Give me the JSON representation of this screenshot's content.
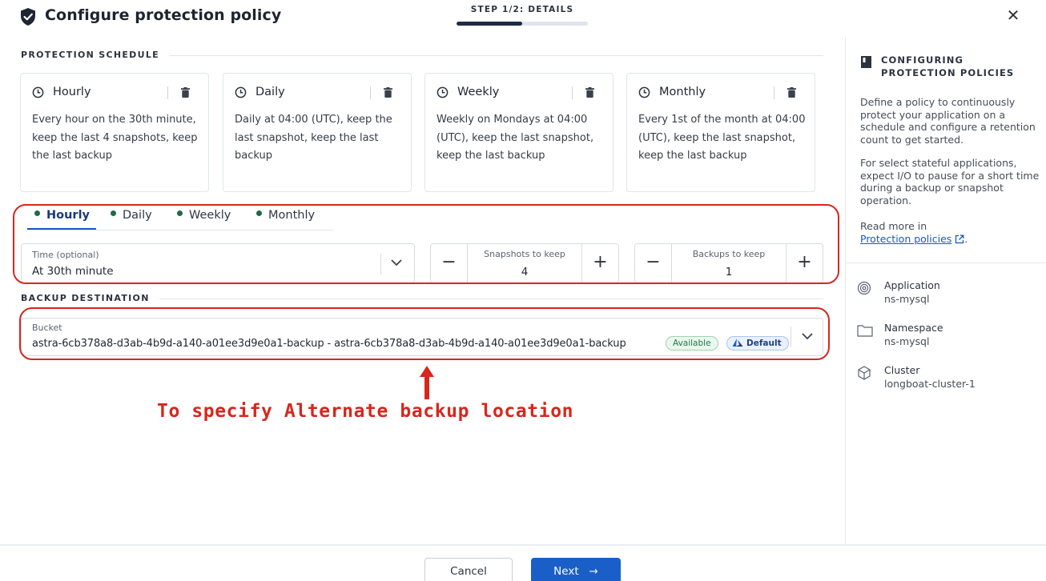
{
  "header": {
    "title": "Configure protection policy",
    "step_label": "STEP 1/2: DETAILS",
    "step_progress": 0.5,
    "close_glyph": "✕"
  },
  "schedule": {
    "heading": "PROTECTION SCHEDULE",
    "cards": [
      {
        "title": "Hourly",
        "description": "Every hour on the 30th minute, keep the last 4 snapshots, keep the last backup"
      },
      {
        "title": "Daily",
        "description": "Daily at 04:00 (UTC), keep the last snapshot, keep the last backup"
      },
      {
        "title": "Weekly",
        "description": "Weekly on Mondays at 04:00 (UTC), keep the last snapshot, keep the last backup"
      },
      {
        "title": "Monthly",
        "description": "Every 1st of the month at 04:00 (UTC), keep the last snapshot, keep the last backup"
      }
    ],
    "tabs": [
      "Hourly",
      "Daily",
      "Weekly",
      "Monthly"
    ],
    "active_tab": "Hourly",
    "time": {
      "label": "Time (optional)",
      "value": "At 30th minute"
    },
    "snapshots": {
      "label": "Snapshots to keep",
      "value": "4",
      "minus": "−",
      "plus": "+"
    },
    "backups": {
      "label": "Backups to keep",
      "value": "1",
      "minus": "−",
      "plus": "+"
    }
  },
  "destination": {
    "heading": "BACKUP DESTINATION",
    "bucket_label": "Bucket",
    "bucket_value": "astra-6cb378a8-d3ab-4b9d-a140-a01ee3d9e0a1-backup - astra-6cb378a8-d3ab-4b9d-a140-a01ee3d9e0a1-backup",
    "badge_available": "Available",
    "badge_default": "Default"
  },
  "annotation": {
    "text": "To specify Alternate backup location",
    "color": "#d8261c"
  },
  "sidebar": {
    "title_line1": "CONFIGURING",
    "title_line2": "PROTECTION POLICIES",
    "para1": "Define a policy to continuously protect your application on a schedule and configure a retention count to get started.",
    "para2": "For select stateful applications, expect I/O to pause for a short time during a backup or snapshot operation.",
    "read_more": "Read more in",
    "link_text": "Protection policies",
    "link_suffix": ".",
    "items": [
      {
        "key": "Application",
        "value": "ns-mysql",
        "icon": "application-icon"
      },
      {
        "key": "Namespace",
        "value": "ns-mysql",
        "icon": "folder-icon"
      },
      {
        "key": "Cluster",
        "value": "longboat-cluster-1",
        "icon": "cluster-icon"
      }
    ]
  },
  "footer": {
    "cancel_label": "Cancel",
    "next_label": "Next",
    "next_arrow": "→"
  },
  "colors": {
    "primary": "#1a5fc7",
    "dot_green": "#1f6b45",
    "annotation_red": "#d8261c"
  }
}
